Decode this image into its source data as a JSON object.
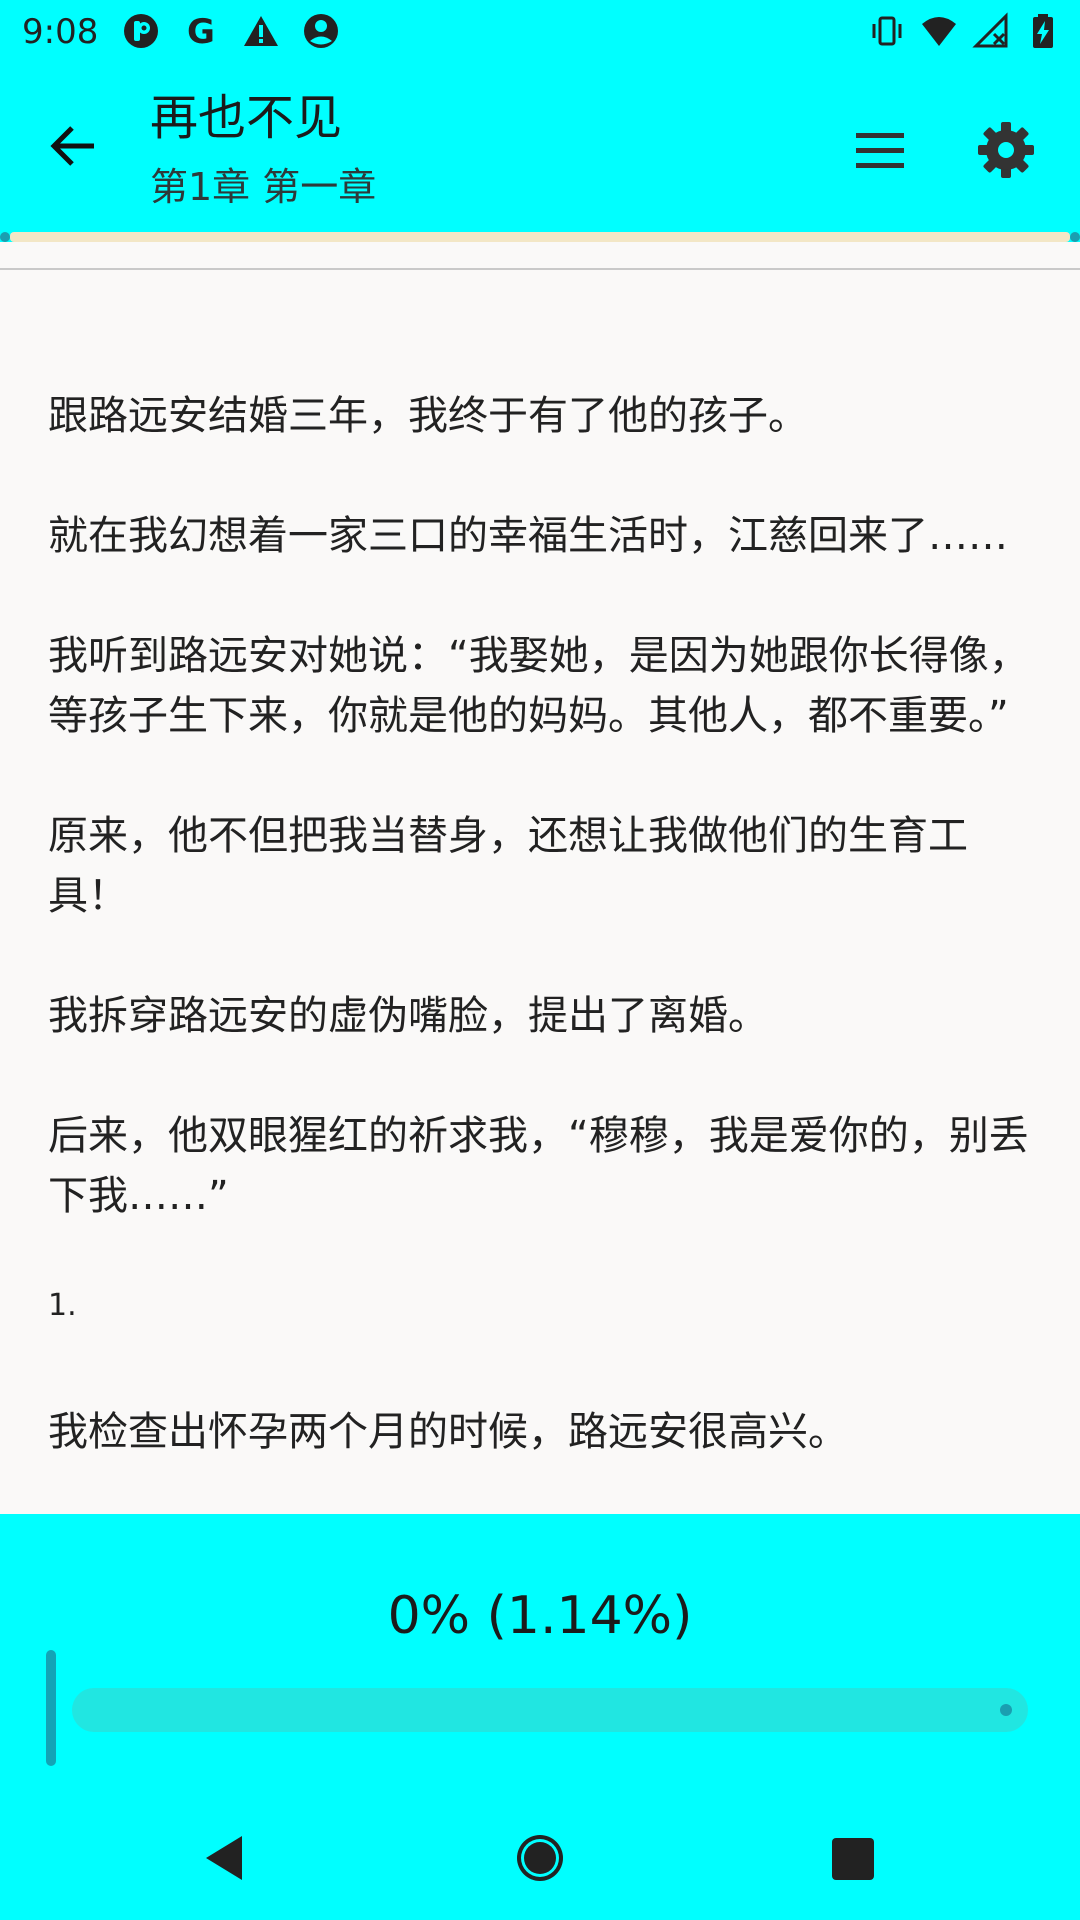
{
  "status_bar": {
    "time": "9:08",
    "left_icons": [
      "pocket-icon",
      "google-icon",
      "warning-icon",
      "account-circle-icon"
    ],
    "right_icons": [
      "vibrate-icon",
      "wifi-icon",
      "no-signal-icon",
      "battery-charging-icon"
    ]
  },
  "app_bar": {
    "back_icon": "arrow-back-icon",
    "title": "再也不见",
    "subtitle": "第1章 第一章",
    "menu_icon": "menu-icon",
    "settings_icon": "settings-icon"
  },
  "content": {
    "paragraphs": [
      "跟路远安结婚三年，我终于有了他的孩子。",
      "就在我幻想着一家三口的幸福生活时，江慈回来了……",
      "我听到路远安对她说：“我娶她，是因为她跟你长得像，等孩子生下来，你就是他的妈妈。其他人，都不重要。”",
      "原来，他不但把我当替身，还想让我做他们的生育工具！",
      "我拆穿路远安的虚伪嘴脸，提出了离婚。",
      "后来，他双眼猩红的祈求我，“穆穆，我是爱你的，别丢下我……”",
      "1.",
      "我检查出怀孕两个月的时候，路远安很高兴。"
    ]
  },
  "bottom": {
    "progress_text": "0% (1.14%)",
    "progress_fraction": 0.0114,
    "nav": {
      "back_icon": "nav-back-icon",
      "home_icon": "nav-home-icon",
      "recent_icon": "nav-recent-icon"
    }
  },
  "colors": {
    "accent": "#00ffff",
    "background": "#faf9f8",
    "text": "#222222",
    "seek_track": "#21e6e1",
    "seek_handle": "#13a4b6"
  }
}
